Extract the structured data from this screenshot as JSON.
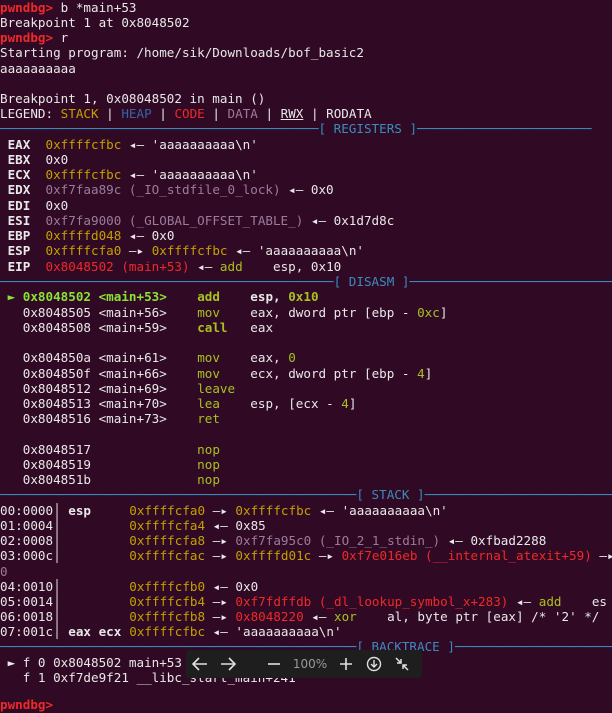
{
  "header": {
    "prompt": "pwndbg>",
    "cmd1": " b *main+53",
    "bp_set": "Breakpoint 1 at 0x8048502",
    "cmd2": " r",
    "starting": "Starting program: /home/sik/Downloads/bof_basic2",
    "input": "aaaaaaaaaa",
    "bp_hit": "Breakpoint 1, 0x08048502 in main ()"
  },
  "legend": {
    "prefix": "LEGEND: ",
    "stack": "STACK",
    "heap": "HEAP",
    "code": "CODE",
    "data": "DATA",
    "rwx": "RWX",
    "rodata": "RODATA"
  },
  "sections": {
    "registers": "[ REGISTERS ]",
    "disasm": "[ DISASM ]",
    "stack": "[ STACK ]",
    "backtrace": "[ BACKTRACE ]"
  },
  "registers": {
    "eax": {
      "name": "EAX",
      "val": "0xffffcfbc",
      "rest": " ◂— 'aaaaaaaaaa\\n'"
    },
    "ebx": {
      "name": "EBX",
      "val": "0x0"
    },
    "ecx": {
      "name": "ECX",
      "val": "0xffffcfbc",
      "rest": " ◂— 'aaaaaaaaaa\\n'"
    },
    "edx": {
      "name": "EDX",
      "val": "0xf7faa89c (_IO_stdfile_0_lock)",
      "rest": " ◂— 0x0"
    },
    "edi": {
      "name": "EDI",
      "val": "0x0"
    },
    "esi": {
      "name": "ESI",
      "val": "0xf7fa9000 (_GLOBAL_OFFSET_TABLE_)",
      "rest": " ◂— 0x1d7d8c"
    },
    "ebp": {
      "name": "EBP",
      "val": "0xffffd048",
      "rest": " ◂— 0x0"
    },
    "esp": {
      "name": "ESP",
      "val": "0xffffcfa0",
      "arrow": " —▸ ",
      "val2": "0xffffcfbc",
      "rest": " ◂— 'aaaaaaaaaa\\n'"
    },
    "eip": {
      "name": "EIP",
      "val": "0x8048502 (main+53)",
      "arrow": " ◂— ",
      "mn": "add",
      "ops": "    esp, 0x10"
    }
  },
  "disasm": [
    {
      "marker": " ► ",
      "addr": "0x8048502",
      "sym": "<main+53>",
      "mn": "add",
      "op1": "esp, ",
      "op2": "0x10"
    },
    {
      "marker": "   ",
      "addr": "0x8048505",
      "sym": "<main+56>",
      "mn": "mov",
      "op1": "eax, dword ptr [ebp - ",
      "op2": "0xc",
      "op3": "]"
    },
    {
      "marker": "   ",
      "addr": "0x8048508",
      "sym": "<main+59>",
      "mn": "call",
      "op1": "eax"
    },
    {
      "marker": "   ",
      "addr": "0x804850a",
      "sym": "<main+61>",
      "mn": "mov",
      "op1": "eax, ",
      "op2": "0"
    },
    {
      "marker": "   ",
      "addr": "0x804850f",
      "sym": "<main+66>",
      "mn": "mov",
      "op1": "ecx, dword ptr [ebp - ",
      "op2": "4",
      "op3": "]"
    },
    {
      "marker": "   ",
      "addr": "0x8048512",
      "sym": "<main+69>",
      "mn": "leave",
      "op1": ""
    },
    {
      "marker": "   ",
      "addr": "0x8048513",
      "sym": "<main+70>",
      "mn": "lea",
      "op1": "esp, [ecx - ",
      "op2": "4",
      "op3": "]"
    },
    {
      "marker": "   ",
      "addr": "0x8048516",
      "sym": "<main+73>",
      "mn": "ret",
      "op1": ""
    },
    {
      "marker": "   ",
      "addr": "0x8048517",
      "sym": "",
      "mn": "nop",
      "op1": ""
    },
    {
      "marker": "   ",
      "addr": "0x8048519",
      "sym": "",
      "mn": "nop",
      "op1": ""
    },
    {
      "marker": "   ",
      "addr": "0x804851b",
      "sym": "",
      "mn": "nop",
      "op1": ""
    }
  ],
  "stack": [
    {
      "idx": "00:0000",
      "reg": "esp",
      "addr": "0xffffcfa0",
      "a": " —▸ ",
      "b": "0xffffcfbc",
      "b_cls": "olive",
      "c": " ◂— 'aaaaaaaaaa\\n'"
    },
    {
      "idx": "01:0004",
      "reg": "",
      "addr": "0xffffcfa4",
      "a": " ◂— 0x85"
    },
    {
      "idx": "02:0008",
      "reg": "",
      "addr": "0xffffcfa8",
      "a": " —▸ ",
      "b": "0xf7fa95c0 (_IO_2_1_stdin_)",
      "b_cls": "purple",
      "c": " ◂— 0xfbad2288"
    },
    {
      "idx": "03:000c",
      "reg": "",
      "addr": "0xffffcfac",
      "a": " —▸ ",
      "b": "0xffffd01c",
      "b_cls": "olive",
      "c": " —▸ ",
      "d": "0xf7e016eb (__internal_atexit+59)",
      "d_cls": "red",
      "e": " —▸"
    },
    {
      "idx": "04:0010",
      "reg": "",
      "addr": "0xffffcfb0",
      "a": " ◂— 0x0"
    },
    {
      "idx": "05:0014",
      "reg": "",
      "addr": "0xffffcfb4",
      "a": " —▸ ",
      "b": "0xf7fdffdb (_dl_lookup_symbol_x+283)",
      "b_cls": "red",
      "c": " ◂— ",
      "mn": "add",
      "ops": "    es"
    },
    {
      "idx": "06:0018",
      "reg": "",
      "addr": "0xffffcfb8",
      "a": " —▸ ",
      "b": "0x8048220",
      "b_cls": "red",
      "c": " ◂— ",
      "mn": "xor",
      "ops": "    al, byte ptr [eax] /* '2' */"
    },
    {
      "idx": "07:001c",
      "reg": "eax ecx",
      "addr": "0xffffcfbc",
      "a": " ◂— 'aaaaaaaaaa\\n'"
    }
  ],
  "stack_wrap": "0",
  "backtrace": [
    {
      "marker": " ► ",
      "frame": "f 0 0x8048502 main+53"
    },
    {
      "marker": "   ",
      "frame": "f 1 0xf7de9f21 __libc_start_main+241"
    }
  ],
  "bottom_prompt": "pwndbg>",
  "viewer": {
    "zoom": "100%",
    "back_icon": "arrow-left-icon",
    "forward_icon": "arrow-right-icon",
    "zoom_out_icon": "minus-icon",
    "zoom_in_icon": "plus-icon",
    "download_icon": "download-icon",
    "fullscreen_icon": "collapse-icon"
  }
}
